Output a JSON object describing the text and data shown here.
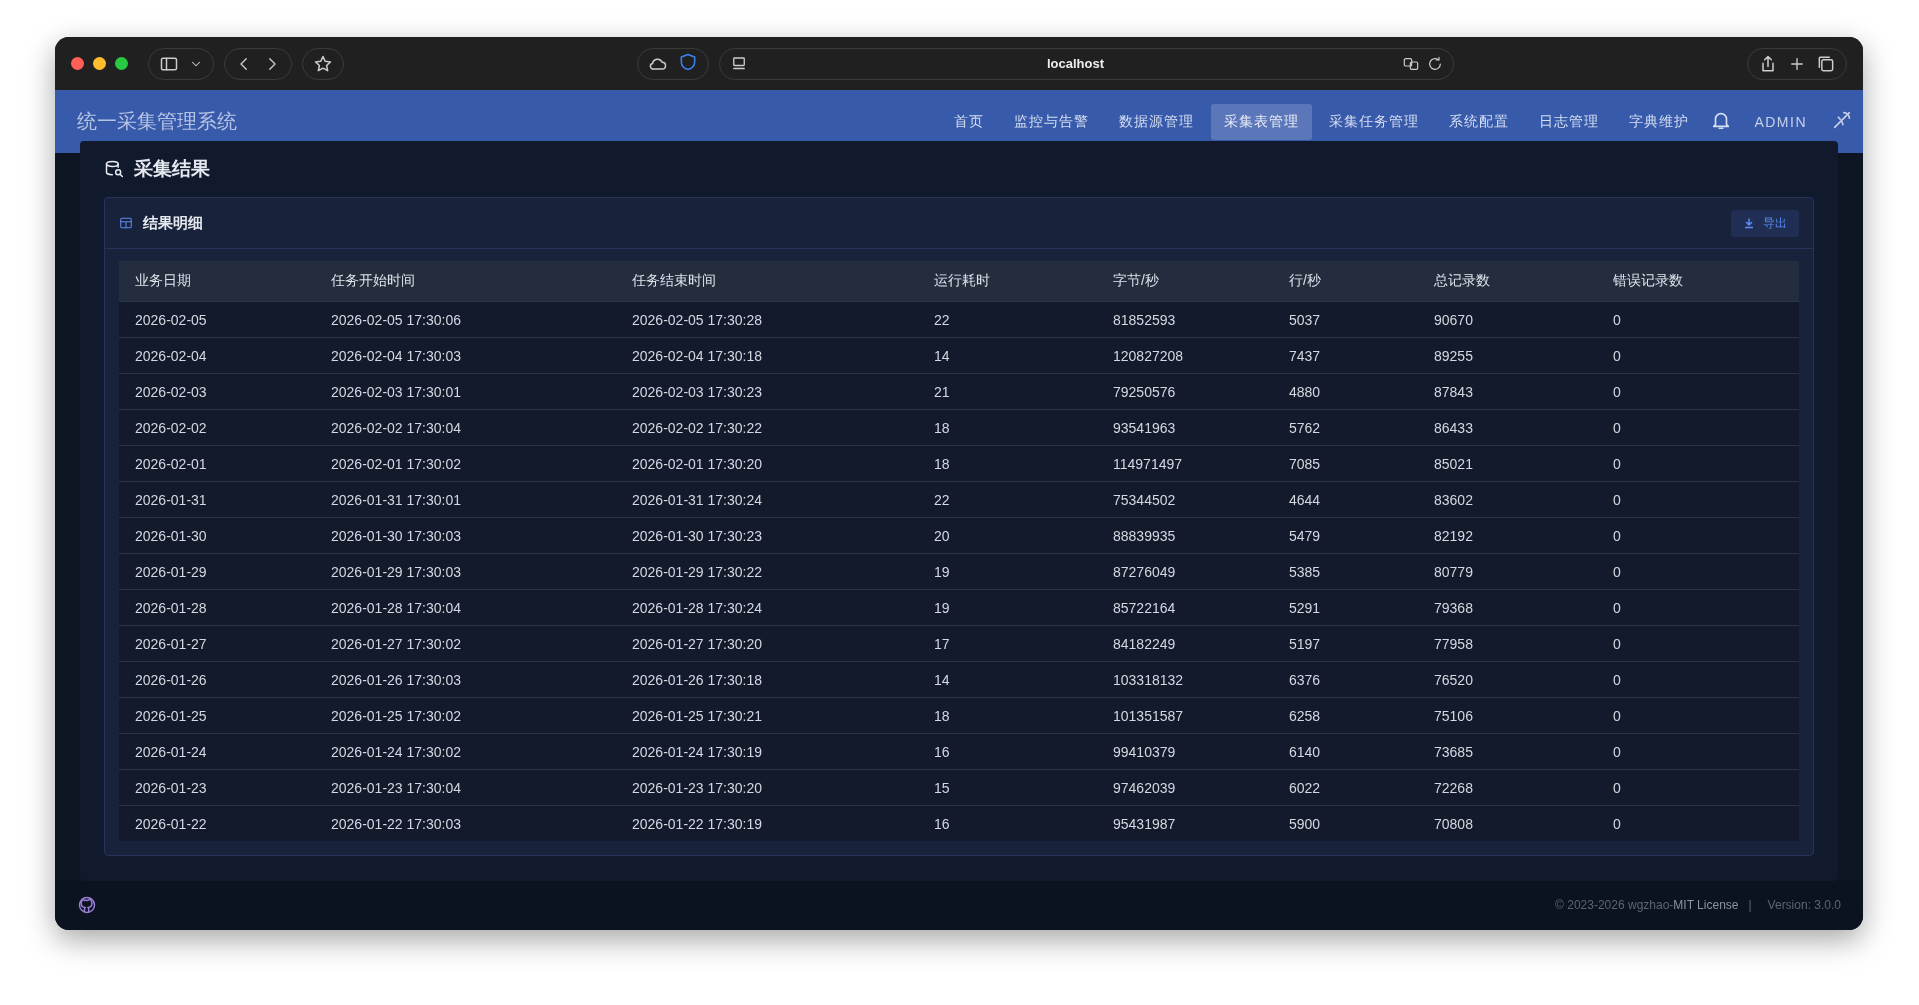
{
  "browser": {
    "url": "localhost"
  },
  "app": {
    "title": "统一采集管理系统",
    "nav": [
      {
        "label": "首页",
        "selected": false
      },
      {
        "label": "监控与告警",
        "selected": false
      },
      {
        "label": "数据源管理",
        "selected": false
      },
      {
        "label": "采集表管理",
        "selected": true
      },
      {
        "label": "采集任务管理",
        "selected": false
      },
      {
        "label": "系统配置",
        "selected": false
      },
      {
        "label": "日志管理",
        "selected": false
      },
      {
        "label": "字典维护",
        "selected": false
      }
    ],
    "user": "ADMIN"
  },
  "dialog": {
    "title": "采集结果",
    "card": {
      "title": "结果明细",
      "export_button": "导出"
    },
    "table": {
      "columns": [
        "业务日期",
        "任务开始时间",
        "任务结束时间",
        "运行耗时",
        "字节/秒",
        "行/秒",
        "总记录数",
        "错误记录数"
      ],
      "rows": [
        [
          "2026-02-05",
          "2026-02-05 17:30:06",
          "2026-02-05 17:30:28",
          "22",
          "81852593",
          "5037",
          "90670",
          "0"
        ],
        [
          "2026-02-04",
          "2026-02-04 17:30:03",
          "2026-02-04 17:30:18",
          "14",
          "120827208",
          "7437",
          "89255",
          "0"
        ],
        [
          "2026-02-03",
          "2026-02-03 17:30:01",
          "2026-02-03 17:30:23",
          "21",
          "79250576",
          "4880",
          "87843",
          "0"
        ],
        [
          "2026-02-02",
          "2026-02-02 17:30:04",
          "2026-02-02 17:30:22",
          "18",
          "93541963",
          "5762",
          "86433",
          "0"
        ],
        [
          "2026-02-01",
          "2026-02-01 17:30:02",
          "2026-02-01 17:30:20",
          "18",
          "114971497",
          "7085",
          "85021",
          "0"
        ],
        [
          "2026-01-31",
          "2026-01-31 17:30:01",
          "2026-01-31 17:30:24",
          "22",
          "75344502",
          "4644",
          "83602",
          "0"
        ],
        [
          "2026-01-30",
          "2026-01-30 17:30:03",
          "2026-01-30 17:30:23",
          "20",
          "88839935",
          "5479",
          "82192",
          "0"
        ],
        [
          "2026-01-29",
          "2026-01-29 17:30:03",
          "2026-01-29 17:30:22",
          "19",
          "87276049",
          "5385",
          "80779",
          "0"
        ],
        [
          "2026-01-28",
          "2026-01-28 17:30:04",
          "2026-01-28 17:30:24",
          "19",
          "85722164",
          "5291",
          "79368",
          "0"
        ],
        [
          "2026-01-27",
          "2026-01-27 17:30:02",
          "2026-01-27 17:30:20",
          "17",
          "84182249",
          "5197",
          "77958",
          "0"
        ],
        [
          "2026-01-26",
          "2026-01-26 17:30:03",
          "2026-01-26 17:30:18",
          "14",
          "103318132",
          "6376",
          "76520",
          "0"
        ],
        [
          "2026-01-25",
          "2026-01-25 17:30:02",
          "2026-01-25 17:30:21",
          "18",
          "101351587",
          "6258",
          "75106",
          "0"
        ],
        [
          "2026-01-24",
          "2026-01-24 17:30:02",
          "2026-01-24 17:30:19",
          "16",
          "99410379",
          "6140",
          "73685",
          "0"
        ],
        [
          "2026-01-23",
          "2026-01-23 17:30:04",
          "2026-01-23 17:30:20",
          "15",
          "97462039",
          "6022",
          "72268",
          "0"
        ],
        [
          "2026-01-22",
          "2026-01-22 17:30:03",
          "2026-01-22 17:30:19",
          "16",
          "95431987",
          "5900",
          "70808",
          "0"
        ]
      ]
    }
  },
  "footer": {
    "copyright": "© 2023-2026 wgzhao-",
    "license_link": "MIT License",
    "separator": "|",
    "version": "Version: 3.0.0"
  }
}
